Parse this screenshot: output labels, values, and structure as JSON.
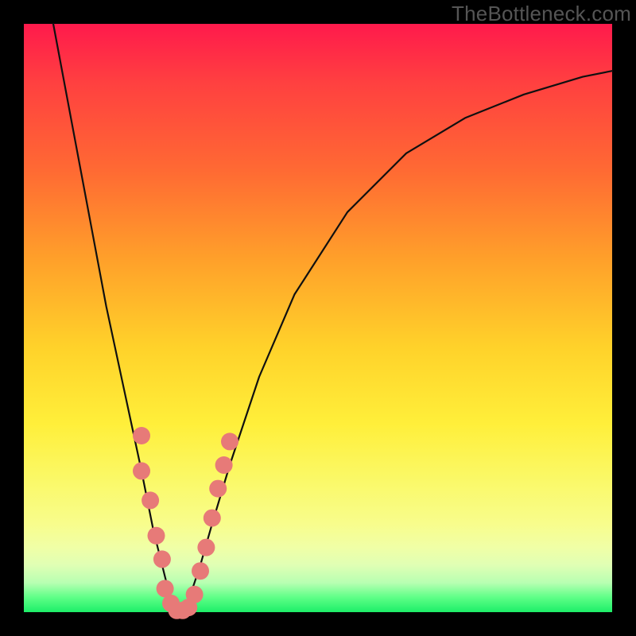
{
  "watermark": {
    "text": "TheBottleneck.com"
  },
  "colors": {
    "marker_fill": "#e77a78",
    "curve_stroke": "#101010",
    "frame": "#000000"
  },
  "chart_data": {
    "type": "line",
    "title": "",
    "xlabel": "",
    "ylabel": "",
    "xlim": [
      0,
      100
    ],
    "ylim": [
      0,
      100
    ],
    "grid": false,
    "series": [
      {
        "name": "bottleneck-curve",
        "description": "V-shaped bottleneck curve; y≈0 at optimum, rises steeply on both sides",
        "x": [
          5,
          8,
          11,
          14,
          17,
          20,
          22,
          24,
          25,
          26,
          27,
          28,
          30,
          32,
          35,
          40,
          46,
          55,
          65,
          75,
          85,
          95,
          100
        ],
        "y": [
          100,
          84,
          68,
          52,
          38,
          24,
          14,
          6,
          2,
          0,
          0,
          2,
          8,
          15,
          25,
          40,
          54,
          68,
          78,
          84,
          88,
          91,
          92
        ]
      }
    ],
    "markers": {
      "name": "highlighted-points",
      "color": "#e77a78",
      "points": [
        {
          "x": 20.0,
          "y": 30.0
        },
        {
          "x": 20.0,
          "y": 24.0
        },
        {
          "x": 21.5,
          "y": 19.0
        },
        {
          "x": 22.5,
          "y": 13.0
        },
        {
          "x": 23.5,
          "y": 9.0
        },
        {
          "x": 24.0,
          "y": 4.0
        },
        {
          "x": 25.0,
          "y": 1.5
        },
        {
          "x": 26.0,
          "y": 0.3
        },
        {
          "x": 27.0,
          "y": 0.3
        },
        {
          "x": 28.0,
          "y": 0.8
        },
        {
          "x": 29.0,
          "y": 3.0
        },
        {
          "x": 30.0,
          "y": 7.0
        },
        {
          "x": 31.0,
          "y": 11.0
        },
        {
          "x": 32.0,
          "y": 16.0
        },
        {
          "x": 33.0,
          "y": 21.0
        },
        {
          "x": 34.0,
          "y": 25.0
        },
        {
          "x": 35.0,
          "y": 29.0
        }
      ]
    }
  }
}
